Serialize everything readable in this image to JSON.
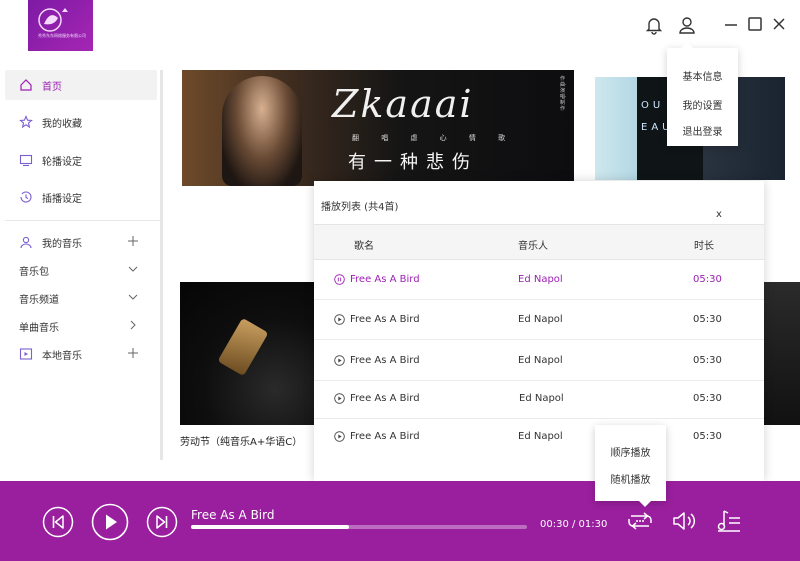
{
  "logo": {
    "caption": "秀秀东东网络服务有限公司"
  },
  "user_menu": {
    "items": [
      "基本信息",
      "我的设置",
      "退出登录"
    ]
  },
  "sidebar": {
    "items": [
      {
        "label": "首页",
        "icon": "home-icon"
      },
      {
        "label": "我的收藏",
        "icon": "star-icon"
      },
      {
        "label": "轮播设定",
        "icon": "screen-icon"
      },
      {
        "label": "插播设定",
        "icon": "history-icon"
      },
      {
        "label": "我的音乐",
        "icon": "user-icon"
      },
      {
        "label": "音乐包",
        "icon": "chevron-down-icon"
      },
      {
        "label": "音乐频道",
        "icon": "chevron-down-icon"
      },
      {
        "label": "单曲音乐",
        "icon": "chevron-right-icon"
      },
      {
        "label": "本地音乐",
        "icon": "play-box-icon"
      }
    ]
  },
  "banner": {
    "title": "Zkaaai",
    "subtitle": "翻 唱 虐 心 情 歌",
    "headline": "有一种悲伤",
    "vertical_text": "作曲·演唱·制作",
    "right_letters": "OU RE O EAUTIFUL"
  },
  "cards": {
    "caption": "劳动节（纯音乐A+华语C）",
    "caption_right": ")"
  },
  "playlist": {
    "title": "播放列表 (共4首)",
    "close": "x",
    "columns": [
      "歌名",
      "音乐人",
      "时长"
    ],
    "rows": [
      {
        "song": "Free As A Bird",
        "artist": "Ed Napol",
        "duration": "05:30"
      },
      {
        "song": "Free As A Bird",
        "artist": "Ed Napol",
        "duration": "05:30"
      },
      {
        "song": "Free As A Bird",
        "artist": "Ed Napol",
        "duration": "05:30"
      },
      {
        "song": "Free As A Bird",
        "artist": "Ed Napol",
        "duration": "05:30"
      },
      {
        "song": "Free As A Bird",
        "artist": "Ed Napol",
        "duration": "05:30"
      }
    ]
  },
  "mode_menu": {
    "items": [
      "顺序播放",
      "随机播放"
    ]
  },
  "player": {
    "title": "Free As A Bird",
    "time": "00:30 / 01:30",
    "progress": 0.47
  },
  "colors": {
    "accent": "#9b1fb3",
    "player_bg": "#9a1f9e"
  }
}
